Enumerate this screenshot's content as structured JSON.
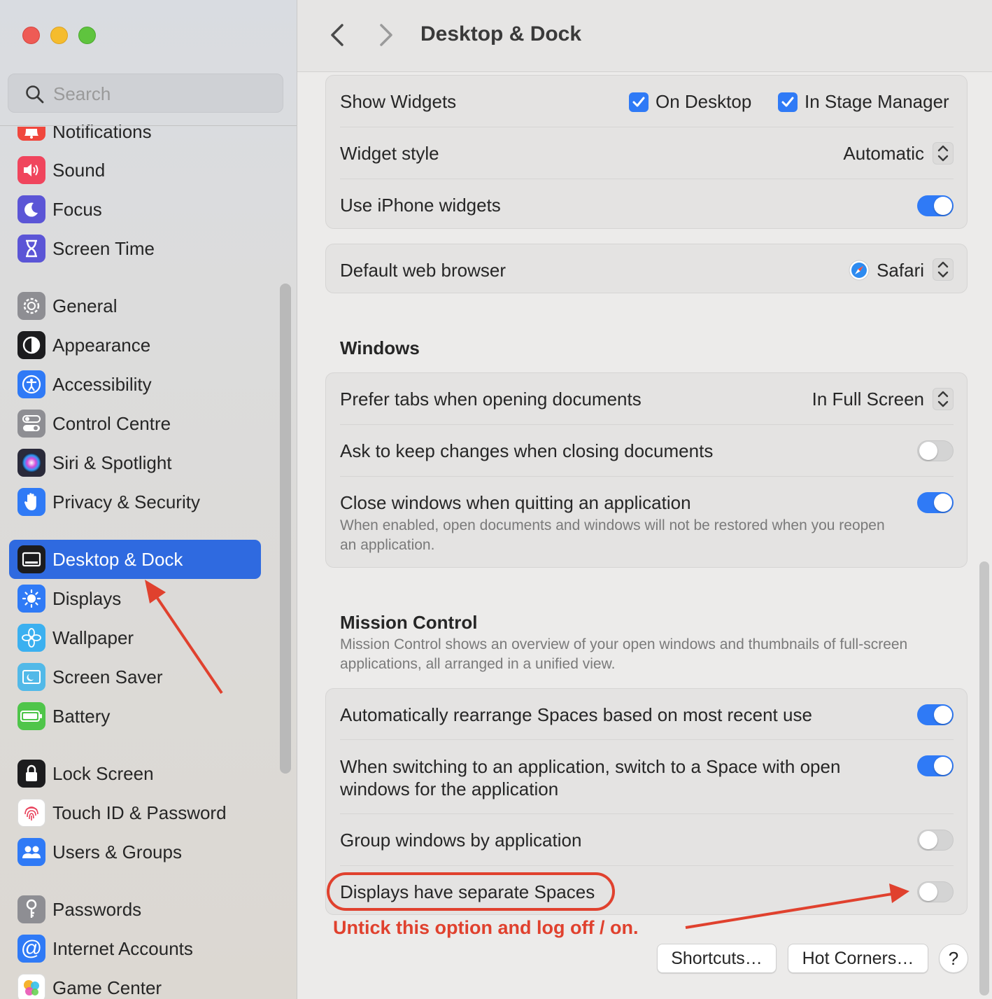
{
  "window": {
    "title": "Desktop & Dock",
    "search_placeholder": "Search"
  },
  "sidebar": {
    "items": [
      {
        "label": "Notifications",
        "icon": "bell-icon",
        "color": "#f0473d"
      },
      {
        "label": "Sound",
        "icon": "speaker-icon",
        "color": "#f0455d"
      },
      {
        "label": "Focus",
        "icon": "moon-icon",
        "color": "#5b55d6"
      },
      {
        "label": "Screen Time",
        "icon": "hourglass-icon",
        "color": "#5b55d6"
      },
      {
        "label": "General",
        "icon": "gear-icon",
        "color": "#8e8e93"
      },
      {
        "label": "Appearance",
        "icon": "appearance-icon",
        "color": "#1c1c1e"
      },
      {
        "label": "Accessibility",
        "icon": "accessibility-icon",
        "color": "#2f7af6"
      },
      {
        "label": "Control Centre",
        "icon": "toggles-icon",
        "color": "#8e8e93"
      },
      {
        "label": "Siri & Spotlight",
        "icon": "siri-icon",
        "color": "#2a2a3a"
      },
      {
        "label": "Privacy & Security",
        "icon": "hand-icon",
        "color": "#2f7af6"
      },
      {
        "label": "Desktop & Dock",
        "icon": "dock-icon",
        "color": "#1c1c1e"
      },
      {
        "label": "Displays",
        "icon": "sun-icon",
        "color": "#2f7af6"
      },
      {
        "label": "Wallpaper",
        "icon": "flower-icon",
        "color": "#3bb0f0"
      },
      {
        "label": "Screen Saver",
        "icon": "screensaver-icon",
        "color": "#52b9e8"
      },
      {
        "label": "Battery",
        "icon": "battery-icon",
        "color": "#4fc54a"
      },
      {
        "label": "Lock Screen",
        "icon": "lock-icon",
        "color": "#1c1c1e"
      },
      {
        "label": "Touch ID & Password",
        "icon": "fingerprint-icon",
        "color": "#ffffff"
      },
      {
        "label": "Users & Groups",
        "icon": "users-icon",
        "color": "#2f7af6"
      },
      {
        "label": "Passwords",
        "icon": "key-icon",
        "color": "#8e8e93"
      },
      {
        "label": "Internet Accounts",
        "icon": "at-icon",
        "color": "#2f7af6"
      },
      {
        "label": "Game Center",
        "icon": "gamecenter-icon",
        "color": "#ffffff"
      }
    ]
  },
  "widgets": {
    "show_widgets_label": "Show Widgets",
    "on_desktop_label": "On Desktop",
    "on_desktop_checked": true,
    "stage_manager_label": "In Stage Manager",
    "stage_manager_checked": true,
    "widget_style_label": "Widget style",
    "widget_style_value": "Automatic",
    "iphone_widgets_label": "Use iPhone widgets",
    "iphone_widgets_on": true
  },
  "browser": {
    "label": "Default web browser",
    "value": "Safari"
  },
  "windows": {
    "title": "Windows",
    "prefer_tabs_label": "Prefer tabs when opening documents",
    "prefer_tabs_value": "In Full Screen",
    "ask_keep_label": "Ask to keep changes when closing documents",
    "ask_keep_on": false,
    "close_windows_label": "Close windows when quitting an application",
    "close_windows_on": true,
    "close_windows_desc": "When enabled, open documents and windows will not be restored when you reopen an application."
  },
  "mission_control": {
    "title": "Mission Control",
    "desc": "Mission Control shows an overview of your open windows and thumbnails of full-screen applications, all arranged in a unified view.",
    "auto_rearrange_label": "Automatically rearrange Spaces based on most recent use",
    "auto_rearrange_on": true,
    "switch_space_label": "When switching to an application, switch to a Space with open windows for the application",
    "switch_space_on": true,
    "group_windows_label": "Group windows by application",
    "group_windows_on": false,
    "separate_spaces_label": "Displays have separate Spaces",
    "separate_spaces_on": false
  },
  "footer": {
    "shortcuts_label": "Shortcuts…",
    "hot_corners_label": "Hot Corners…",
    "help_label": "?"
  },
  "annotation": {
    "text": "Untick this option and log off / on.",
    "color": "#e0412e"
  },
  "colors": {
    "accent": "#2f7af6",
    "sidebar_selected": "#2f6ae0"
  }
}
